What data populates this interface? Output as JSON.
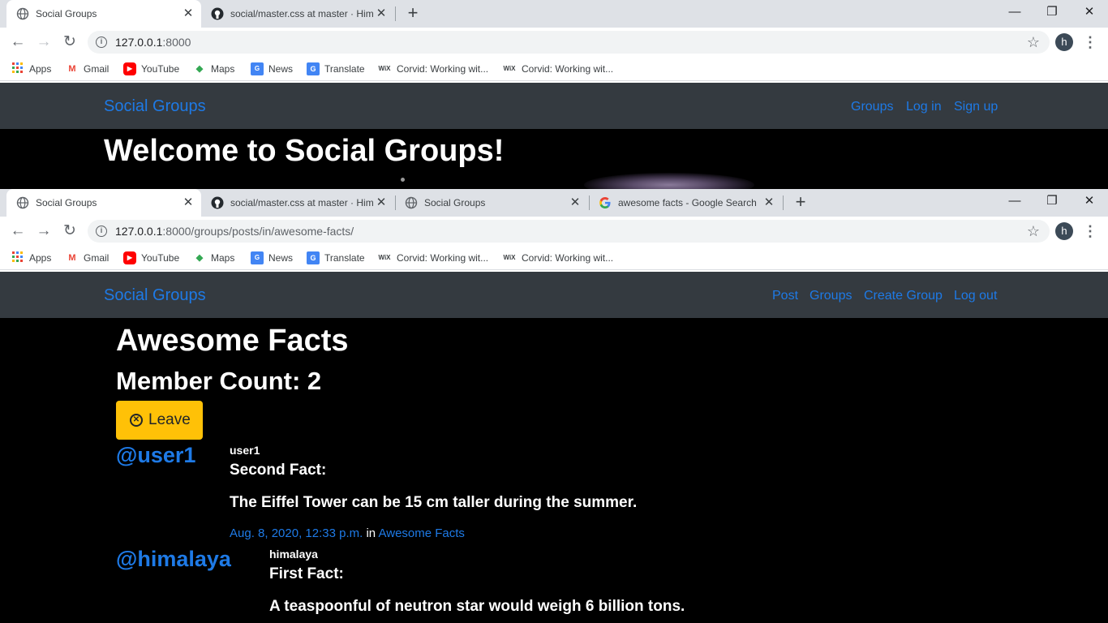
{
  "window1": {
    "tabs": [
      {
        "title": "Social Groups",
        "icon": "globe-icon"
      },
      {
        "title": "social/master.css at master · Him",
        "icon": "github-icon"
      }
    ],
    "url": {
      "host": "127.0.0.1",
      "rest": ":8000"
    },
    "avatar": "h",
    "bookmarks": [
      "Apps",
      "Gmail",
      "YouTube",
      "Maps",
      "News",
      "Translate",
      "Corvid: Working wit...",
      "Corvid: Working wit..."
    ],
    "site": {
      "brand": "Social Groups",
      "nav": [
        "Groups",
        "Log in",
        "Sign up"
      ],
      "jumbotron_title": "Welcome to Social Groups!"
    }
  },
  "window2": {
    "tabs": [
      {
        "title": "Social Groups",
        "icon": "globe-icon"
      },
      {
        "title": "social/master.css at master · Him",
        "icon": "github-icon"
      },
      {
        "title": "Social Groups",
        "icon": "globe-icon"
      },
      {
        "title": "awesome facts - Google Search",
        "icon": "google-icon"
      }
    ],
    "url": {
      "host": "127.0.0.1",
      "rest": ":8000/groups/posts/in/awesome-facts/"
    },
    "avatar": "h",
    "bookmarks": [
      "Apps",
      "Gmail",
      "YouTube",
      "Maps",
      "News",
      "Translate",
      "Corvid: Working wit...",
      "Corvid: Working wit..."
    ],
    "site": {
      "brand": "Social Groups",
      "nav": [
        "Post",
        "Groups",
        "Create Group",
        "Log out"
      ]
    },
    "group": {
      "name": "Awesome Facts",
      "member_count": "Member Count: 2",
      "leave_label": "Leave"
    },
    "posts": [
      {
        "handle": "@user1",
        "username": "user1",
        "title": "Second Fact:",
        "body": "The Eiffel Tower can be 15 cm taller during the summer.",
        "date": "Aug. 8, 2020, 12:33 p.m.",
        "in_word": "in",
        "group": "Awesome Facts"
      },
      {
        "handle": "@himalaya",
        "username": "himalaya",
        "title": "First Fact:",
        "body": "A teaspoonful of neutron star would weigh 6 billion tons."
      }
    ]
  },
  "colors": {
    "chrome_tabstrip": "#dee1e6",
    "navbar": "#343a40",
    "link": "#1e7ae6",
    "warning_button": "#ffc107",
    "page_bg": "#000000"
  }
}
